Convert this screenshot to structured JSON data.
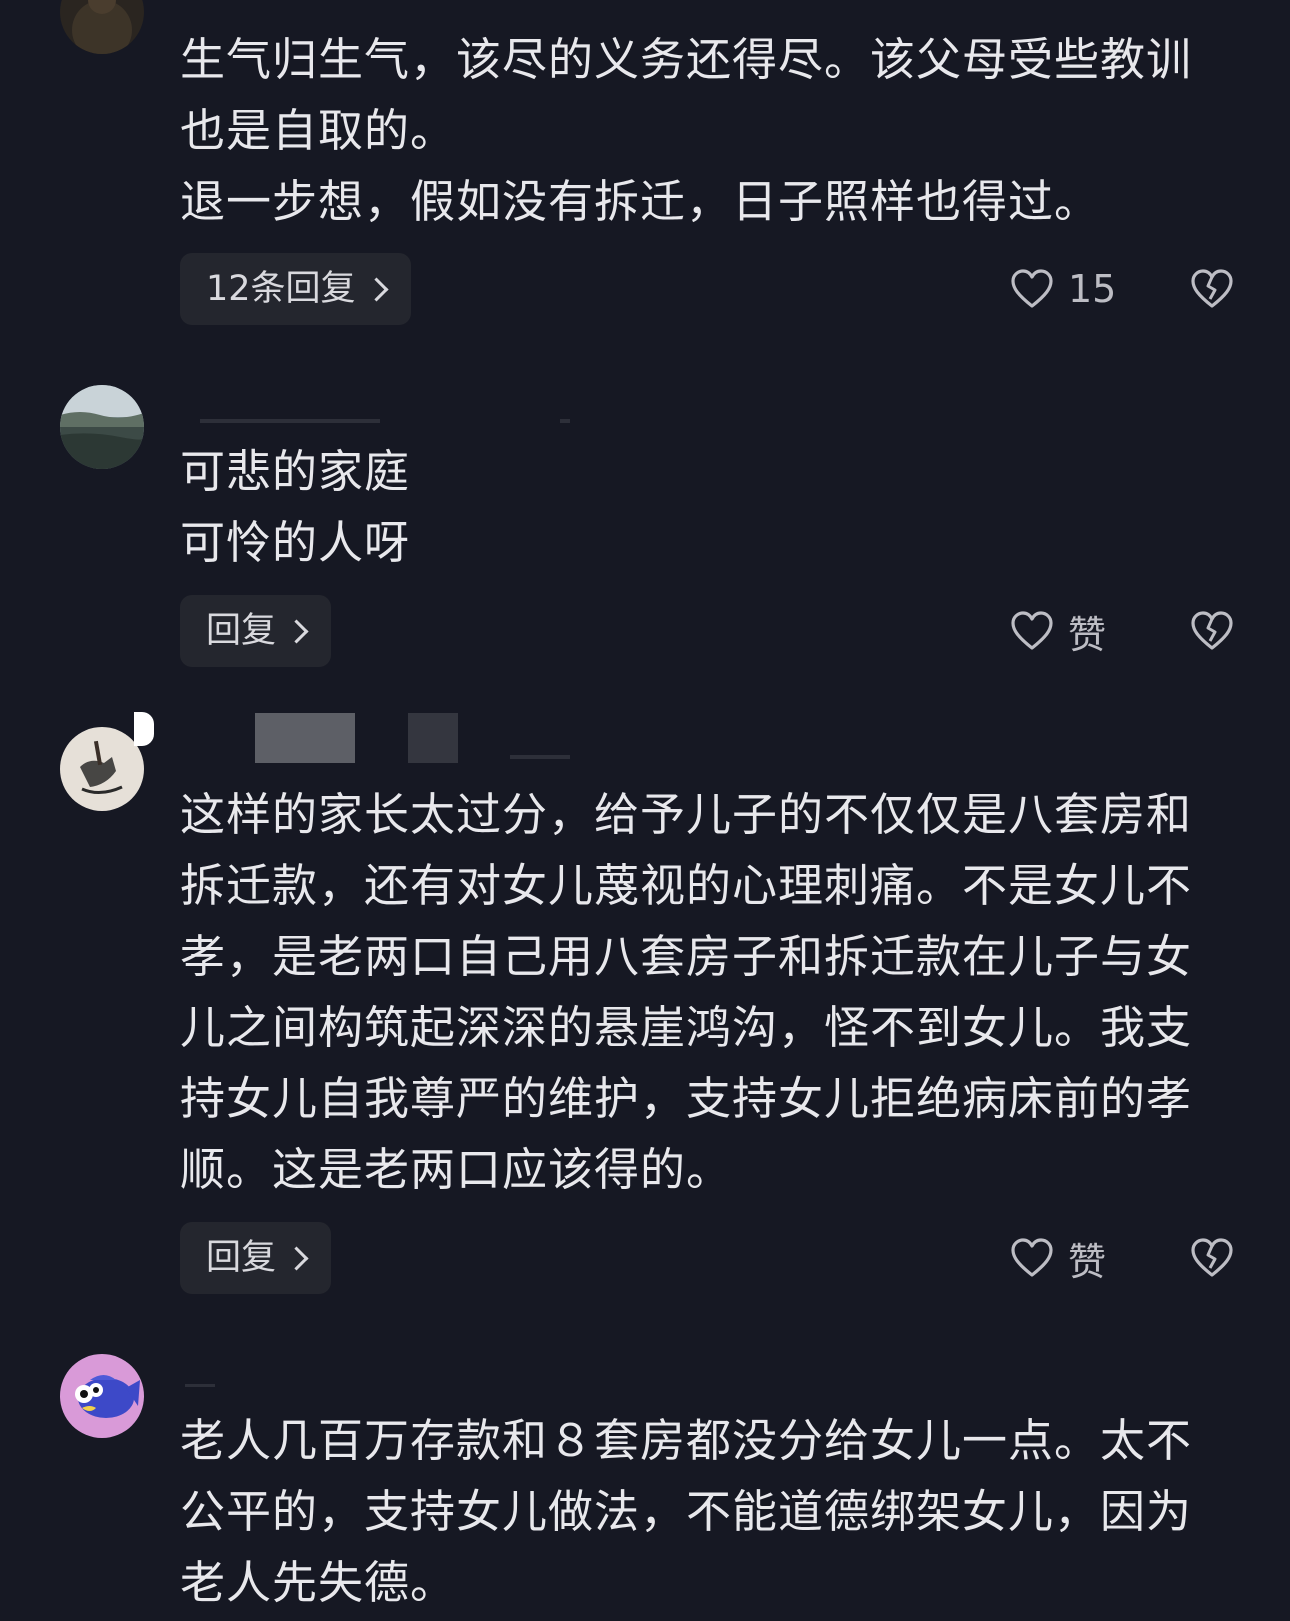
{
  "comments": [
    {
      "lines": [
        "生气归生气，该尽的义务还得尽。该父母受些教训",
        "也是自取的。",
        "退一步想，假如没有拆迁，日子照样也得过。"
      ],
      "reply_label": "12条回复",
      "like_label": "15",
      "avatar_icon": "user-avatar-dark",
      "like_icon": "heart-outline-icon",
      "dislike_icon": "broken-heart-icon"
    },
    {
      "lines": [
        "可悲的家庭",
        "可怜的人呀"
      ],
      "reply_label": "回复",
      "like_label": "赞",
      "avatar_icon": "user-avatar-lake",
      "like_icon": "heart-outline-icon",
      "dislike_icon": "broken-heart-icon"
    },
    {
      "lines": [
        "这样的家长太过分，给予儿子的不仅仅是八套房和",
        "拆迁款，还有对女儿蔑视的心理刺痛。不是女儿不",
        "孝，是老两口自己用八套房子和拆迁款在儿子与女",
        "儿之间构筑起深深的悬崖鸿沟，怪不到女儿。我支",
        "持女儿自我尊严的维护，支持女儿拒绝病床前的孝",
        "顺。这是老两口应该得的。"
      ],
      "reply_label": "回复",
      "like_label": "赞",
      "avatar_icon": "user-avatar-calligraphy",
      "like_icon": "heart-outline-icon",
      "dislike_icon": "broken-heart-icon"
    },
    {
      "lines": [
        "老人几百万存款和８套房都没分给女儿一点。太不",
        "公平的，支持女儿做法，不能道德绑架女儿，因为",
        "老人先失德。"
      ],
      "avatar_icon": "user-avatar-fish"
    }
  ],
  "colors": {
    "background": "#161823",
    "text": "#e8e8ec",
    "reply_bg": "#24262e",
    "icon": "#bdbdc4"
  }
}
